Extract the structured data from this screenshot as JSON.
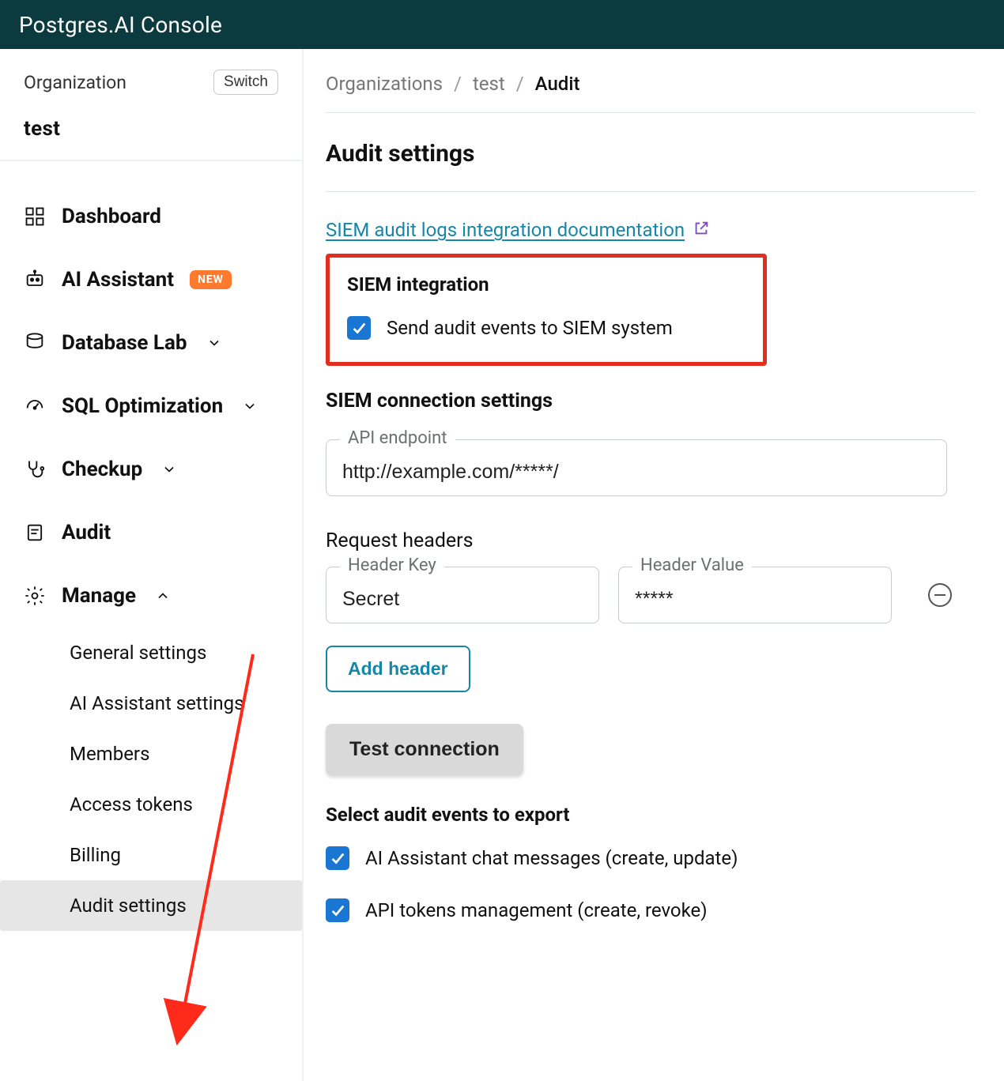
{
  "topbar": {
    "title": "Postgres.AI Console"
  },
  "sidebar": {
    "org_label": "Organization",
    "switch_label": "Switch",
    "org_name": "test",
    "items": [
      {
        "label": "Dashboard"
      },
      {
        "label": "AI Assistant",
        "badge": "NEW"
      },
      {
        "label": "Database Lab"
      },
      {
        "label": "SQL Optimization"
      },
      {
        "label": "Checkup"
      },
      {
        "label": "Audit"
      },
      {
        "label": "Manage"
      }
    ],
    "manage_sub": [
      {
        "label": "General settings"
      },
      {
        "label": "AI Assistant settings"
      },
      {
        "label": "Members"
      },
      {
        "label": "Access tokens"
      },
      {
        "label": "Billing"
      },
      {
        "label": "Audit settings"
      }
    ]
  },
  "breadcrumbs": {
    "a": "Organizations",
    "b": "test",
    "c": "Audit"
  },
  "page": {
    "title": "Audit settings",
    "doc_link": "SIEM audit logs integration documentation",
    "siem": {
      "header": "SIEM integration",
      "checkbox_label": "Send audit events to SIEM system"
    },
    "conn": {
      "header": "SIEM connection settings",
      "api_label": "API endpoint",
      "api_value": "http://example.com/*****/",
      "req_headers_header": "Request headers",
      "hkey_label": "Header Key",
      "hkey_value": "Secret",
      "hval_label": "Header Value",
      "hval_value": "*****",
      "add_header": "Add header",
      "test_conn": "Test connection"
    },
    "export": {
      "header": "Select audit events to export",
      "items": [
        {
          "label": "AI Assistant chat messages (create, update)"
        },
        {
          "label": "API tokens management (create, revoke)"
        }
      ]
    }
  }
}
